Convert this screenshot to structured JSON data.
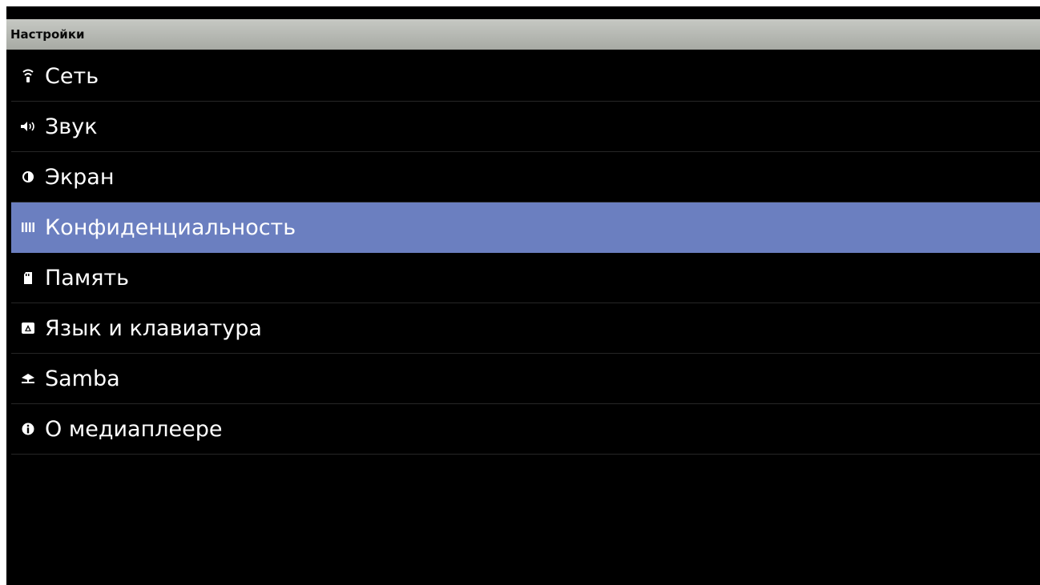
{
  "window": {
    "title": "Настройки"
  },
  "menu": {
    "selected_index": 3,
    "items": [
      {
        "label": "Сеть",
        "icon": "wifi-icon"
      },
      {
        "label": "Звук",
        "icon": "speaker-icon"
      },
      {
        "label": "Экран",
        "icon": "brightness-icon"
      },
      {
        "label": "Конфиденциальность",
        "icon": "privacy-icon"
      },
      {
        "label": "Память",
        "icon": "storage-icon"
      },
      {
        "label": "Язык и клавиатура",
        "icon": "keyboard-icon"
      },
      {
        "label": "Samba",
        "icon": "network-share-icon"
      },
      {
        "label": "О медиаплеере",
        "icon": "info-icon"
      }
    ]
  },
  "colors": {
    "background": "#000000",
    "title_bar": "#b5b8b2",
    "selection": "#6b7fc0",
    "text": "#ffffff",
    "divider": "#262626"
  }
}
